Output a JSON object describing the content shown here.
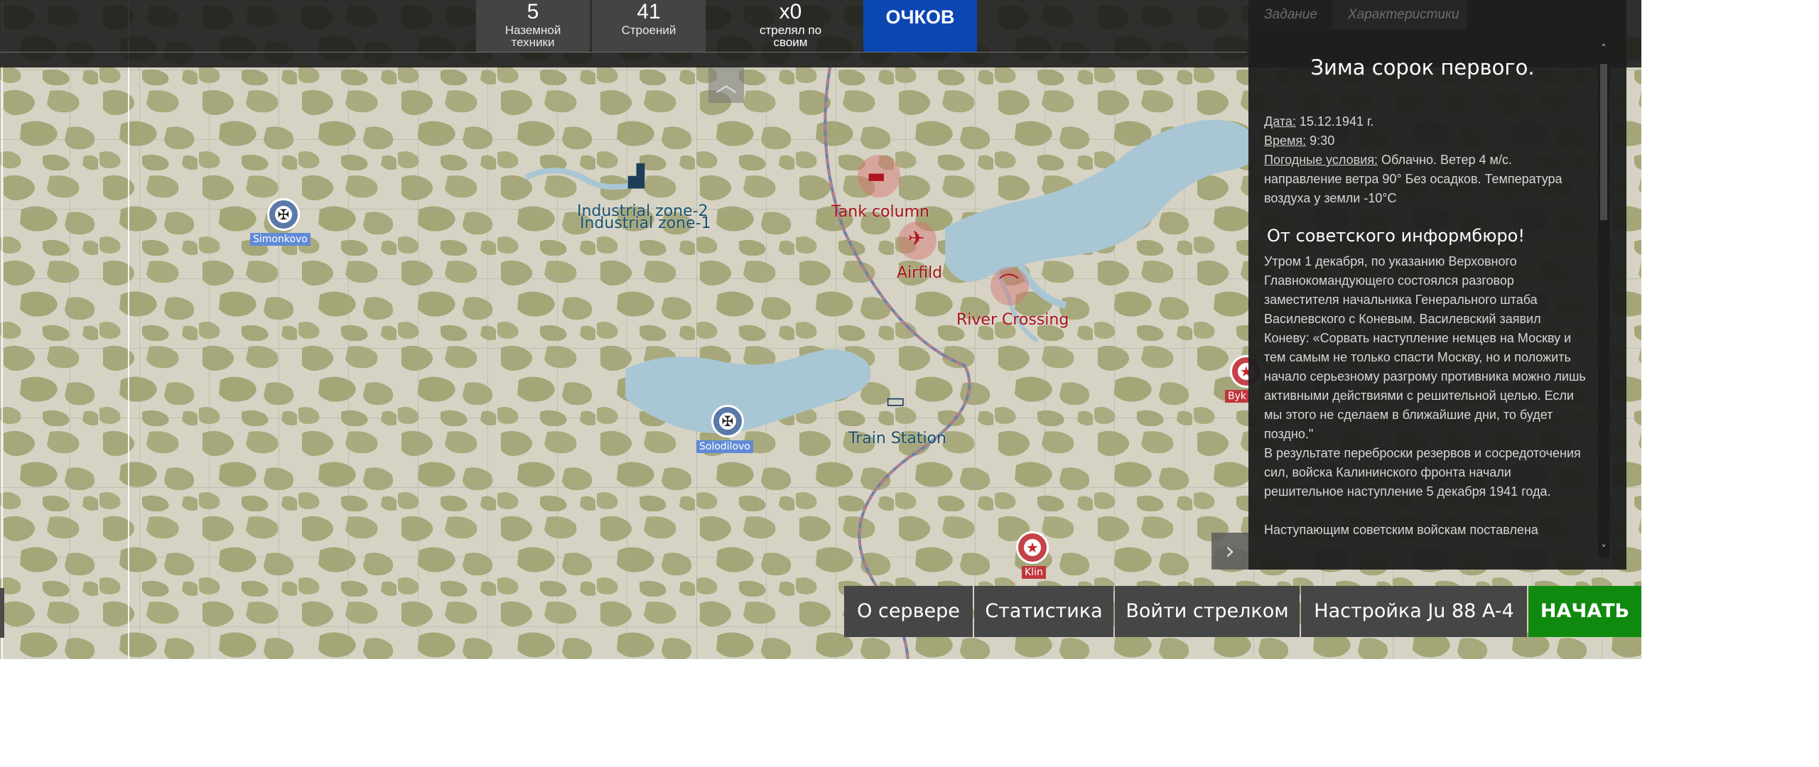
{
  "top_bar": {
    "stats": [
      {
        "value": "5",
        "label": "Наземной техники"
      },
      {
        "value": "41",
        "label": "Строений"
      },
      {
        "value": "x0",
        "label": "стрелял по своим"
      }
    ],
    "score_button": "ОЧКОВ"
  },
  "panel": {
    "tabs": [
      "Задание",
      "Характеристики"
    ],
    "title": "Зима сорок первого.",
    "meta": [
      {
        "key": "Дата:",
        "value": "15.12.1941 г."
      },
      {
        "key": "Время:",
        "value": "9:30"
      },
      {
        "key": "Погодные условия:",
        "value": "Облачно. Ветер 4 м/с. направление ветра 90° Без осадков.  Температура воздуха у земли -10°C"
      }
    ],
    "heading": "От советского информбюро!",
    "paragraphs": [
      " Утром 1 декабря, по указанию Верховного Главнокомандующего состоялся разговор заместителя начальника Генерального штаба Василевского с Коневым. Василевский заявил Коневу: «Сорвать наступление немцев на Москву и тем самым не только спасти Москву, но и положить начало серьезному разгрому противника можно лишь активными действиями с решительной целью. Если мы этого не сделаем в ближайшие дни, то будет поздно.\"",
      " В результате переброски резервов и сосредоточения сил, войска Калининского фронта начали решительное наступление 5 декабря 1941 года."
    ],
    "final_line": "Наступающим советским войскам поставлена"
  },
  "map": {
    "objectives": [
      {
        "label": "Industrial zone-2",
        "side": "blue",
        "icon": "factory-icon"
      },
      {
        "label": "Industrial zone-1",
        "side": "blue",
        "icon": "factory-icon"
      },
      {
        "label": "Tank column",
        "side": "red",
        "icon": "tank-icon"
      },
      {
        "label": "Airfild",
        "side": "red",
        "icon": "plane-icon"
      },
      {
        "label": "River Crossing",
        "side": "red",
        "icon": "bridge-icon"
      },
      {
        "label": "Train Station",
        "side": "blue",
        "icon": "train-icon"
      }
    ],
    "airbases": [
      {
        "label": "Simonkovo",
        "side": "blue",
        "icon": "cross-icon"
      },
      {
        "label": "Solodilovo",
        "side": "blue",
        "icon": "cross-icon"
      },
      {
        "label": "Klin",
        "side": "red",
        "icon": "star-icon"
      },
      {
        "label": "Byk",
        "side": "red",
        "icon": "star-icon"
      }
    ]
  },
  "actions": {
    "about_server": "О сервере",
    "statistics": "Статистика",
    "enter_gunner": "Войти стрелком",
    "setup_aircraft": "Настройка Ju 88 A-4",
    "start": "НАЧАТЬ"
  },
  "colors": {
    "accent_blue": "#0b47b3",
    "start_green": "#0f8a0f",
    "enemy_red": "#a8101a",
    "friendly_blue": "#17506e"
  }
}
